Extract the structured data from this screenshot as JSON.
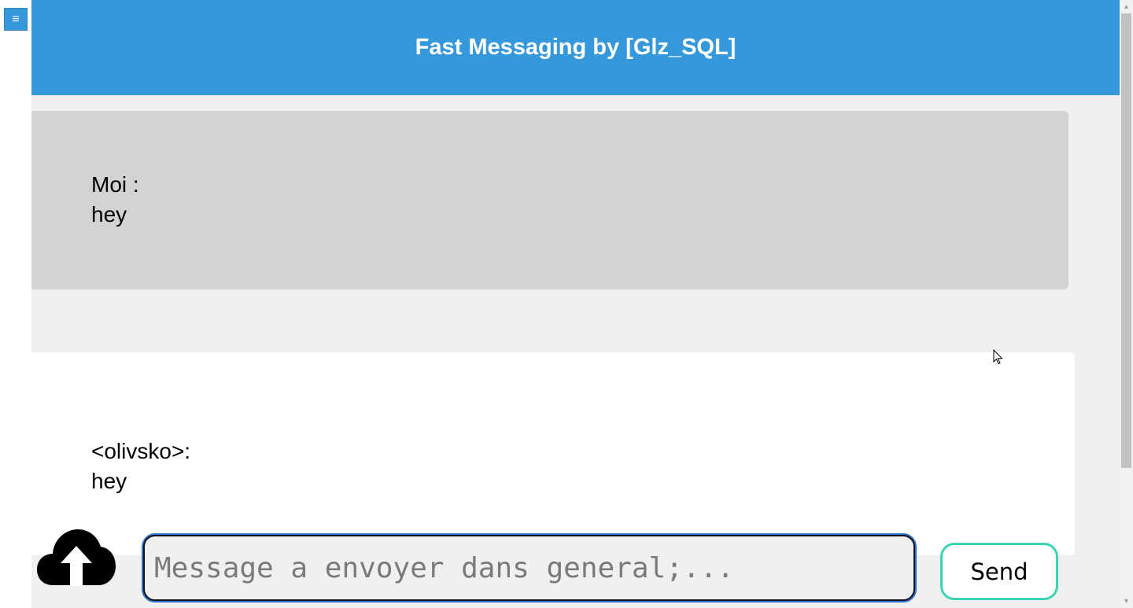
{
  "sidebar": {
    "toggle_icon": "menu-icon",
    "toggle_glyph": "≡"
  },
  "header": {
    "title": "Fast Messaging by [Glz_SQL]"
  },
  "messages": [
    {
      "author": "Moi :",
      "text": "hey",
      "own": true
    },
    {
      "author": "<olivsko>:",
      "text": "hey",
      "own": false
    }
  ],
  "composer": {
    "upload_icon": "cloud-upload-icon",
    "placeholder": "Message a envoyer dans general;...",
    "value": "",
    "send_label": "Send"
  },
  "colors": {
    "header": "#3498db",
    "own_message": "#d3d3d3",
    "other_message": "#ffffff",
    "background": "#f0f0f0",
    "send_border": "#3ad6b4"
  },
  "scrollbar": {
    "up_glyph": "▲",
    "down_glyph": "▼"
  }
}
